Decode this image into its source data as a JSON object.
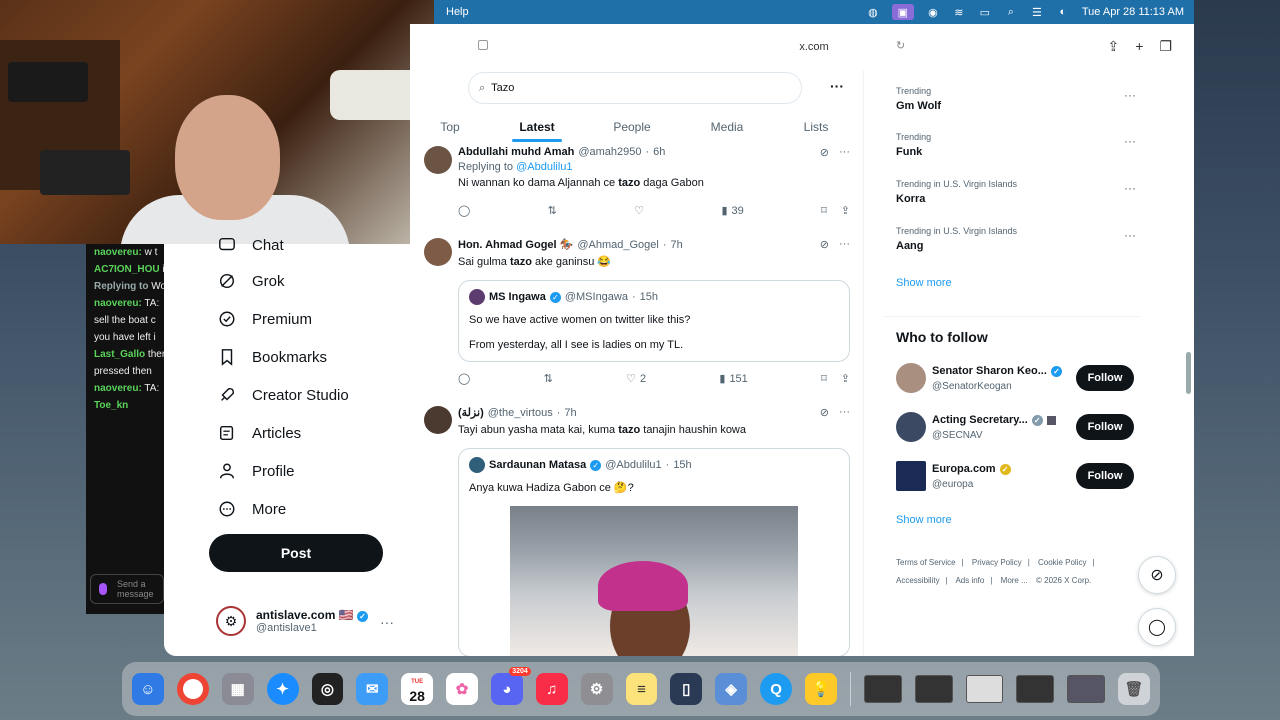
{
  "menubar": {
    "app_menu": "Help",
    "datetime": "Tue Apr 28  11:13 AM"
  },
  "browser": {
    "url": "x.com"
  },
  "chat": {
    "lines": [
      {
        "user": "naovereu:",
        "text": "w t",
        "color": "#5ad35a"
      },
      {
        "user": "AC7ION_HOU",
        "text": "is peggy",
        "color": "#5ad35a"
      },
      {
        "user": "Replying to",
        "text": "Wolseley:",
        "color": "#9aa"
      },
      {
        "user": "naovereu:",
        "text": "TA:",
        "color": "#5ad35a"
      },
      {
        "user": "",
        "text": "sell the boat c",
        "color": "#eee"
      },
      {
        "user": "",
        "text": "you have left i",
        "color": "#eee"
      },
      {
        "user": "Last_Gallo",
        "text": "there like a ret",
        "color": "#5ad35a"
      },
      {
        "user": "",
        "text": "pressed then",
        "color": "#eee"
      },
      {
        "user": "naovereu:",
        "text": "TA:",
        "color": "#5ad35a"
      },
      {
        "user": "Toe_kn",
        "text": "",
        "color": "#5ad35a"
      }
    ],
    "input_placeholder": "Send a message"
  },
  "nav": {
    "items": [
      {
        "label": "Chat",
        "icon": "chat-icon"
      },
      {
        "label": "Grok",
        "icon": "grok-icon"
      },
      {
        "label": "Premium",
        "icon": "premium-icon"
      },
      {
        "label": "Bookmarks",
        "icon": "bookmark-icon"
      },
      {
        "label": "Creator Studio",
        "icon": "rocket-icon"
      },
      {
        "label": "Articles",
        "icon": "articles-icon"
      },
      {
        "label": "Profile",
        "icon": "profile-icon"
      },
      {
        "label": "More",
        "icon": "more-circle-icon"
      }
    ],
    "post_label": "Post",
    "account": {
      "name": "antislave.com 🇺🇸",
      "handle": "@antislave1"
    }
  },
  "search": {
    "query": "Tazo"
  },
  "tabs": [
    "Top",
    "Latest",
    "People",
    "Media",
    "Lists"
  ],
  "active_tab": "Latest",
  "tweets": [
    {
      "name": "Abdullahi muhd Amah",
      "handle": "@amah2950",
      "time": "6h",
      "replying_prefix": "Replying to",
      "replying_to": "@Abdulilu1",
      "text_before": "Ni wannan ko dama Aljannah ce ",
      "text_highlight": "tazo",
      "text_after": " daga Gabon",
      "views": "39",
      "likes": ""
    },
    {
      "name": "Hon. Ahmad Gogel 🏇🏼",
      "handle": "@Ahmad_Gogel",
      "time": "7h",
      "text_before": "Sai gulma ",
      "text_highlight": "tazo",
      "text_after": " ake ganinsu 😂",
      "quote": {
        "name": "MS Ingawa",
        "handle": "@MSIngawa",
        "time": "15h",
        "line1": "So we have active women on twitter like this?",
        "line2": "From yesterday, all I see is ladies on my TL."
      },
      "likes": "2",
      "views": "151"
    },
    {
      "name": "(نزلة)",
      "handle": "@the_virtous",
      "time": "7h",
      "text_before": "Tayi abun yasha mata kai, kuma ",
      "text_highlight": "tazo",
      "text_after": " tanajin haushin kowa",
      "quote": {
        "name": "Sardaunan Matasa",
        "handle": "@Abdulilu1",
        "time": "15h",
        "line1": "Anya kuwa Hadiza Gabon ce 🤔?"
      }
    }
  ],
  "trends": [
    {
      "context": "Trending",
      "name": "Gm Wolf"
    },
    {
      "context": "Trending",
      "name": "Funk"
    },
    {
      "context": "Trending in U.S. Virgin Islands",
      "name": "Korra"
    },
    {
      "context": "Trending in U.S. Virgin Islands",
      "name": "Aang"
    }
  ],
  "show_more": "Show more",
  "who_to_follow": {
    "title": "Who to follow",
    "accounts": [
      {
        "name": "Senator Sharon Keo...",
        "handle": "@SenatorKeogan",
        "badge": "blue"
      },
      {
        "name": "Acting Secretary...",
        "handle": "@SECNAV",
        "badge": "grey"
      },
      {
        "name": "Europa.com",
        "handle": "@europa",
        "badge": "gold"
      }
    ],
    "follow_label": "Follow"
  },
  "footer": {
    "links": [
      "Terms of Service",
      "|",
      "Privacy Policy",
      "|",
      "Cookie Policy",
      "|",
      "Accessibility",
      "|",
      "Ads info",
      "|",
      "More ...",
      "© 2026 X Corp."
    ]
  },
  "dock": {
    "calendar_day": "28",
    "calendar_month": "TUE",
    "discord_badge": "3204"
  }
}
